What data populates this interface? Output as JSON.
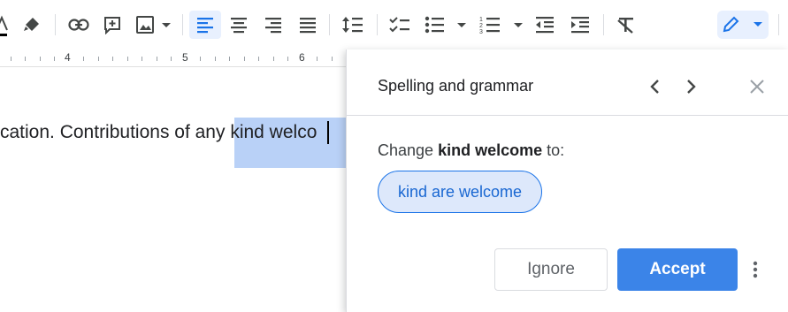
{
  "toolbar": {
    "items": [
      "text-color",
      "highlight",
      "insert-link",
      "add-comment",
      "insert-image",
      "align-left",
      "align-center",
      "align-right",
      "justify",
      "line-spacing",
      "checklist",
      "bulleted-list",
      "numbered-list",
      "decrease-indent",
      "increase-indent",
      "clear-formatting",
      "editing-mode"
    ],
    "active_item": "align-left",
    "accent_color": "#1a73e8"
  },
  "ruler": {
    "numbers": [
      "4",
      "5",
      "6"
    ]
  },
  "document": {
    "text_before": "cation. Contributions of any ",
    "selected_text": "kind welco",
    "selection_color": "#b9d1f7"
  },
  "spelling_panel": {
    "title": "Spelling and grammar",
    "change_prefix": "Change",
    "change_target": "kind welcome",
    "change_suffix": "to:",
    "suggestion": "kind are welcome",
    "ignore_label": "Ignore",
    "accept_label": "Accept",
    "accept_color": "#3b84e8",
    "icons": [
      "previous-icon",
      "next-icon",
      "close-icon",
      "more-options-icon"
    ]
  }
}
